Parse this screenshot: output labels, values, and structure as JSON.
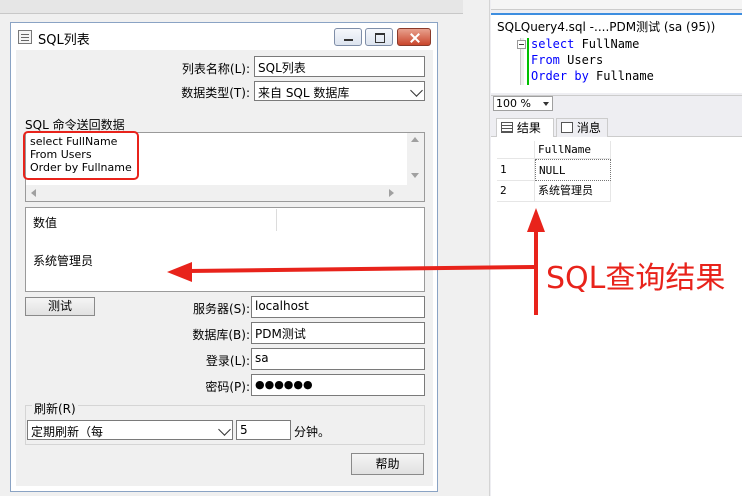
{
  "dialog": {
    "title": "SQL列表",
    "list_name_label": "列表名称(L):",
    "list_name_value": "SQL列表",
    "data_type_label": "数据类型(T):",
    "data_type_value": "来自 SQL 数据库",
    "sql_section_label": "SQL 命令送回数据",
    "sql_lines": [
      "select FullName",
      "From Users",
      "Order by Fullname"
    ],
    "result_header": "数值",
    "result_value": "系统管理员",
    "test_button": "测试",
    "server_label": "服务器(S):",
    "server_value": "localhost",
    "database_label": "数据库(B):",
    "database_value": "PDM测试",
    "login_label": "登录(L):",
    "login_value": "sa",
    "password_label": "密码(P):",
    "password_value": "●●●●●●",
    "refresh_group_label": "刷新(R)",
    "refresh_mode_value": "定期刷新（每",
    "refresh_interval_value": "5",
    "refresh_unit": "分钟。",
    "help_button": "帮助"
  },
  "ssms": {
    "tab_title": "SQLQuery4.sql -....PDM测试 (sa (95))",
    "code_lines": [
      {
        "kw": "select",
        "rest": " FullName"
      },
      {
        "kw": "From",
        "rest": " Users"
      },
      {
        "kw": "Order by",
        "rest": " Fullname"
      }
    ],
    "zoom": "100 %",
    "results_tab": "结果",
    "messages_tab": "消息",
    "grid_header": "FullName",
    "grid_rows": [
      {
        "num": "1",
        "value": "NULL"
      },
      {
        "num": "2",
        "value": "系统管理员"
      }
    ]
  },
  "annotation": "SQL查询结果",
  "colors": {
    "annotation_red": "#e8231b",
    "keyword_blue": "#0000ff",
    "tab_accent": "#3d8ee0"
  }
}
